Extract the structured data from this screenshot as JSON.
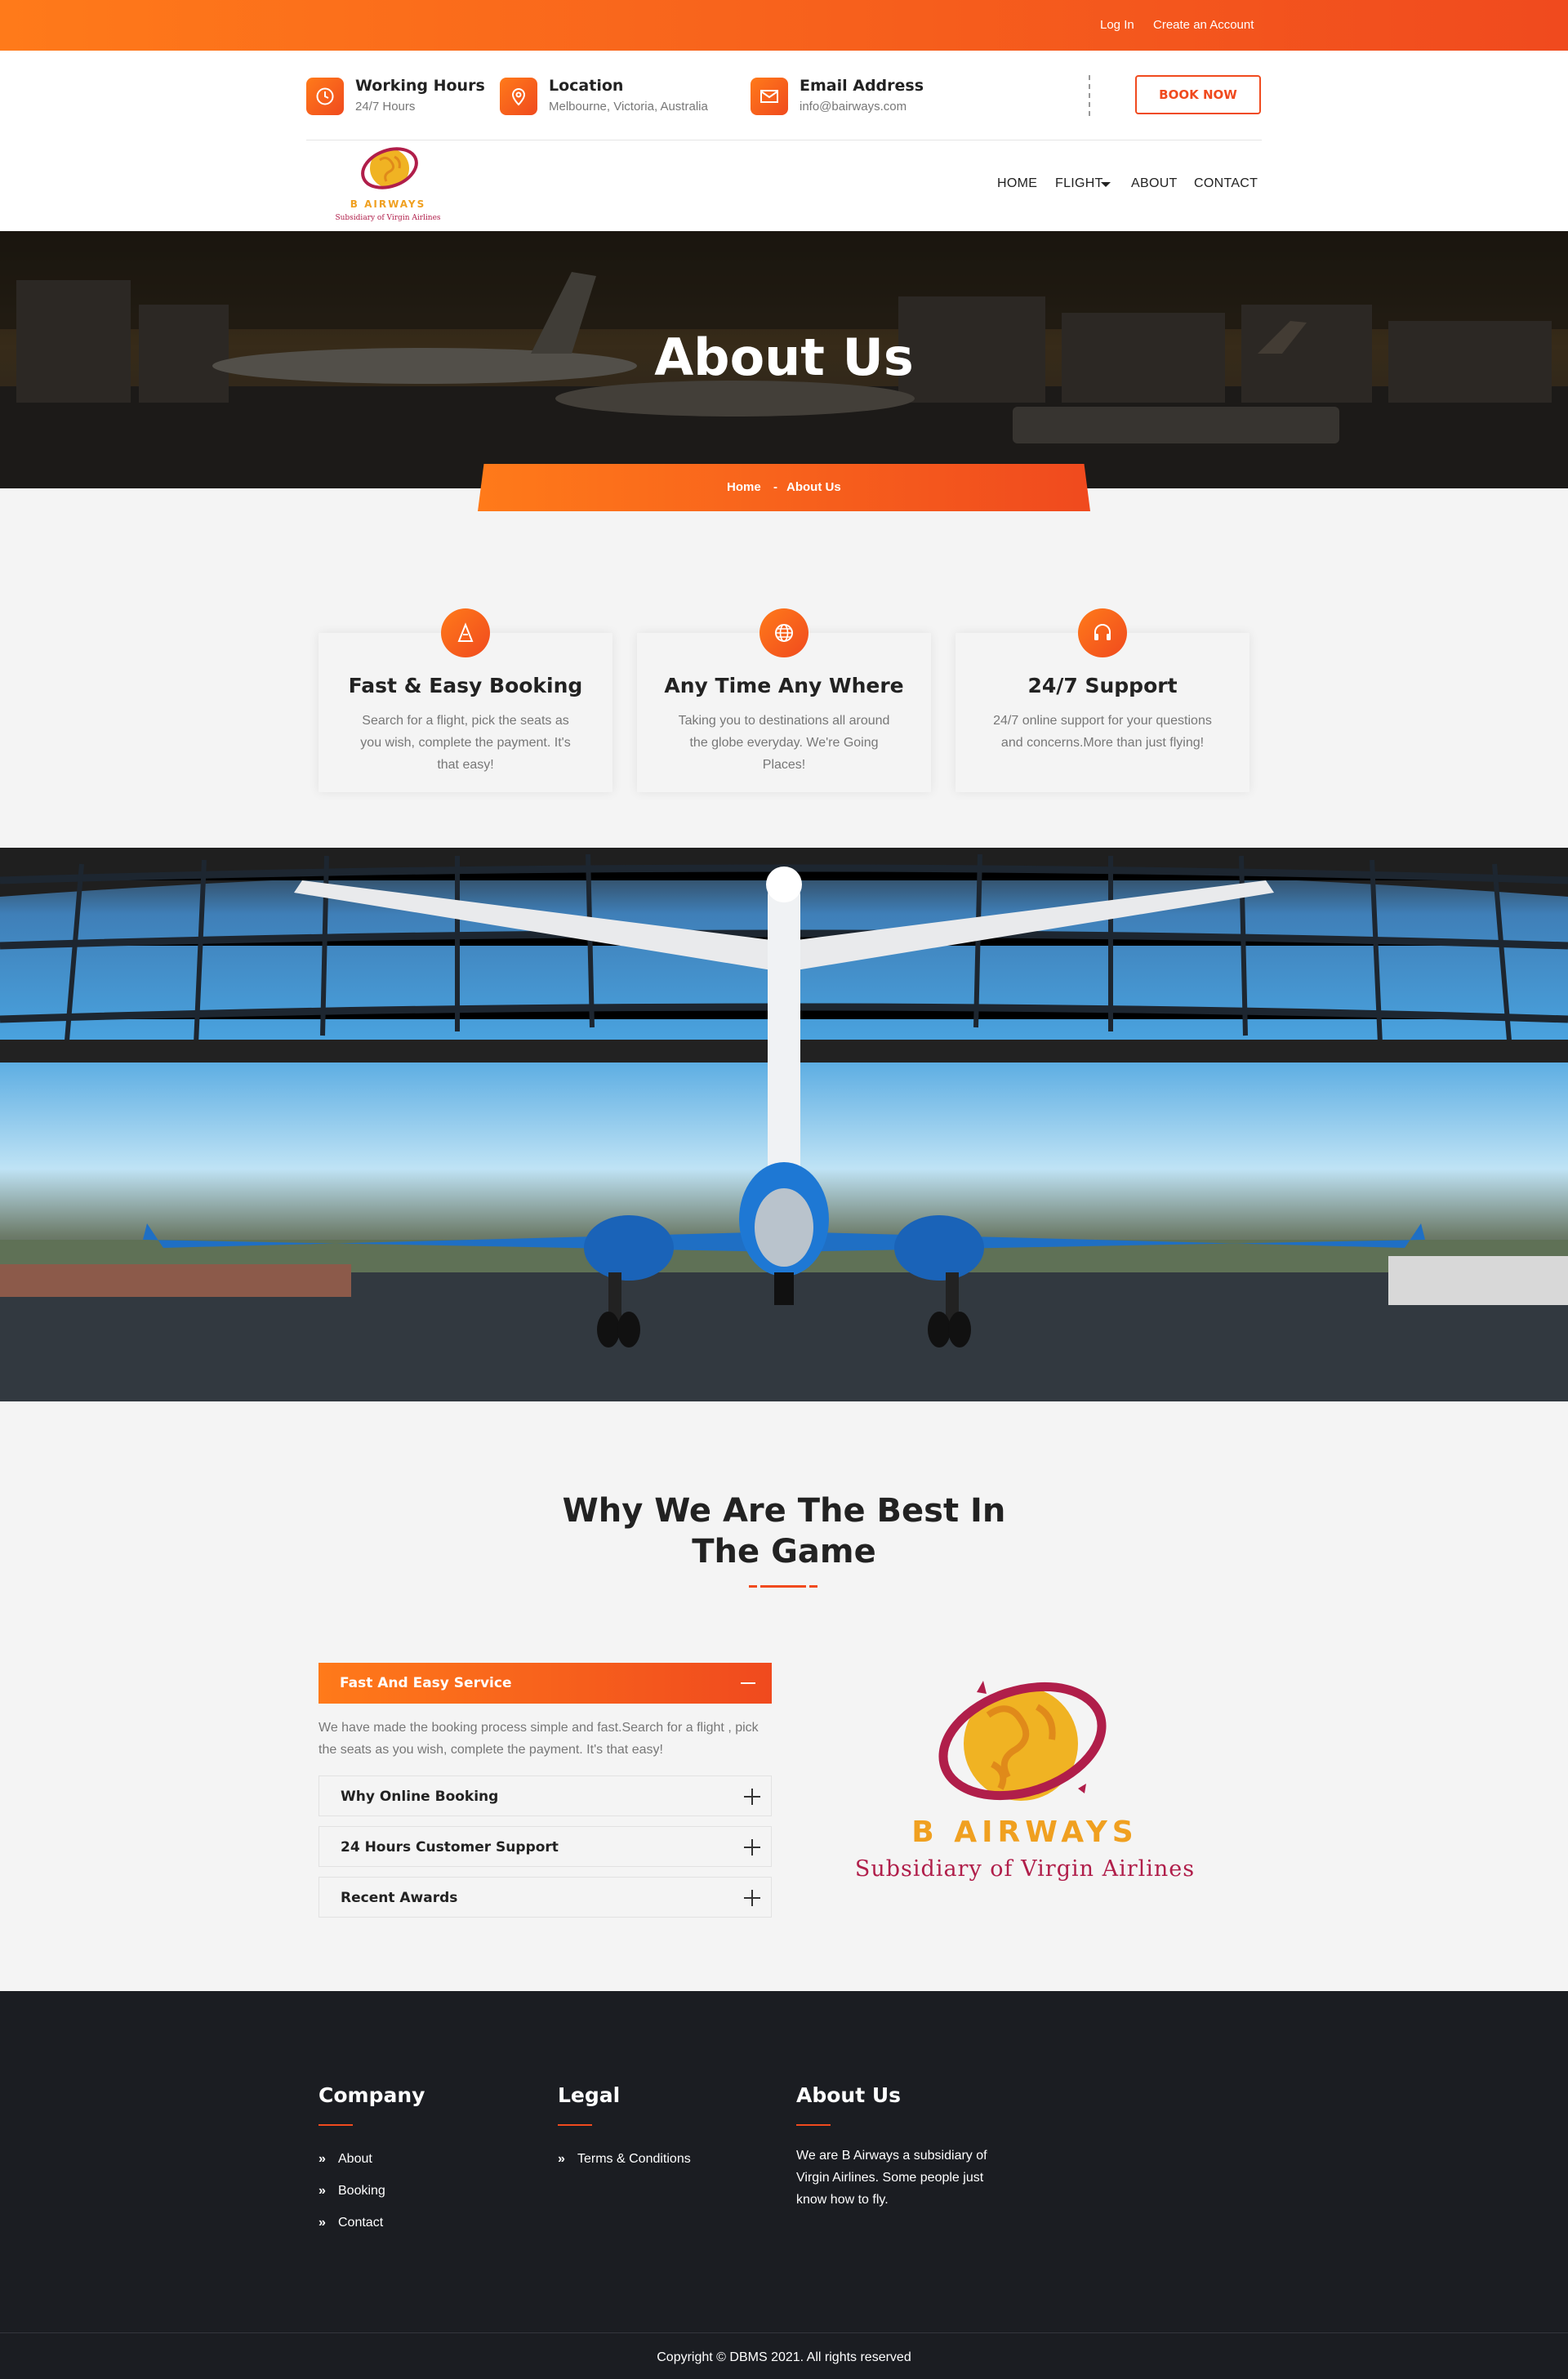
{
  "topbar": {
    "login": "Log In",
    "create_account": "Create an Account"
  },
  "header": {
    "working_hours": {
      "title": "Working Hours",
      "value": "24/7 Hours",
      "icon": "clock-icon"
    },
    "location": {
      "title": "Location",
      "value": "Melbourne, Victoria, Australia",
      "icon": "location-pin-icon"
    },
    "email": {
      "title": "Email Address",
      "value": "info@bairways.com",
      "icon": "envelope-icon"
    },
    "book_now": "BOOK NOW"
  },
  "logo": {
    "name": "B AIRWAYS",
    "tagline": "Subsidiary of Virgin Airlines"
  },
  "nav": {
    "home": "HOME",
    "flight": "FLIGHT",
    "about": "ABOUT",
    "contact": "CONTACT"
  },
  "hero": {
    "title": "About Us",
    "breadcrumb_home": "Home",
    "breadcrumb_sep": "-",
    "breadcrumb_current": "About Us"
  },
  "features": [
    {
      "title": "Fast & Easy Booking",
      "text": "Search for a flight, pick the seats as you wish, complete the payment. It's that easy!",
      "icon": "road-cone-icon"
    },
    {
      "title": "Any Time Any Where",
      "text": "Taking you to destinations all around the globe everyday. We're Going Places!",
      "icon": "globe-icon"
    },
    {
      "title": "24/7 Support",
      "text": "24/7 online support for your questions and concerns.More than just flying!",
      "icon": "headset-icon"
    }
  ],
  "why": {
    "title_line1": "Why We Are The Best In",
    "title_line2": "The Game",
    "accordion": [
      {
        "title": "Fast And Easy Service",
        "text": "We have made the booking process simple and fast.Search for a flight , pick the seats as you wish, complete the payment. It's that easy!",
        "open": true
      },
      {
        "title": "Why Online Booking",
        "open": false
      },
      {
        "title": "24 Hours Customer Support",
        "open": false
      },
      {
        "title": "Recent Awards",
        "open": false
      }
    ]
  },
  "footer": {
    "company": {
      "title": "Company",
      "links": [
        "About",
        "Booking",
        "Contact"
      ]
    },
    "legal": {
      "title": "Legal",
      "links": [
        "Terms & Conditions"
      ]
    },
    "about": {
      "title": "About Us",
      "text": "We are B Airways a subsidiary of Virgin Airlines. Some people just know how to fly."
    },
    "copyright": "Copyright © DBMS 2021. All rights reserved"
  },
  "colors": {
    "accent_start": "#ff7a1a",
    "accent_end": "#f04a1e",
    "footer_bg": "#1b1d22",
    "logo_gold": "#f0b323",
    "logo_crimson": "#b01e4a"
  }
}
